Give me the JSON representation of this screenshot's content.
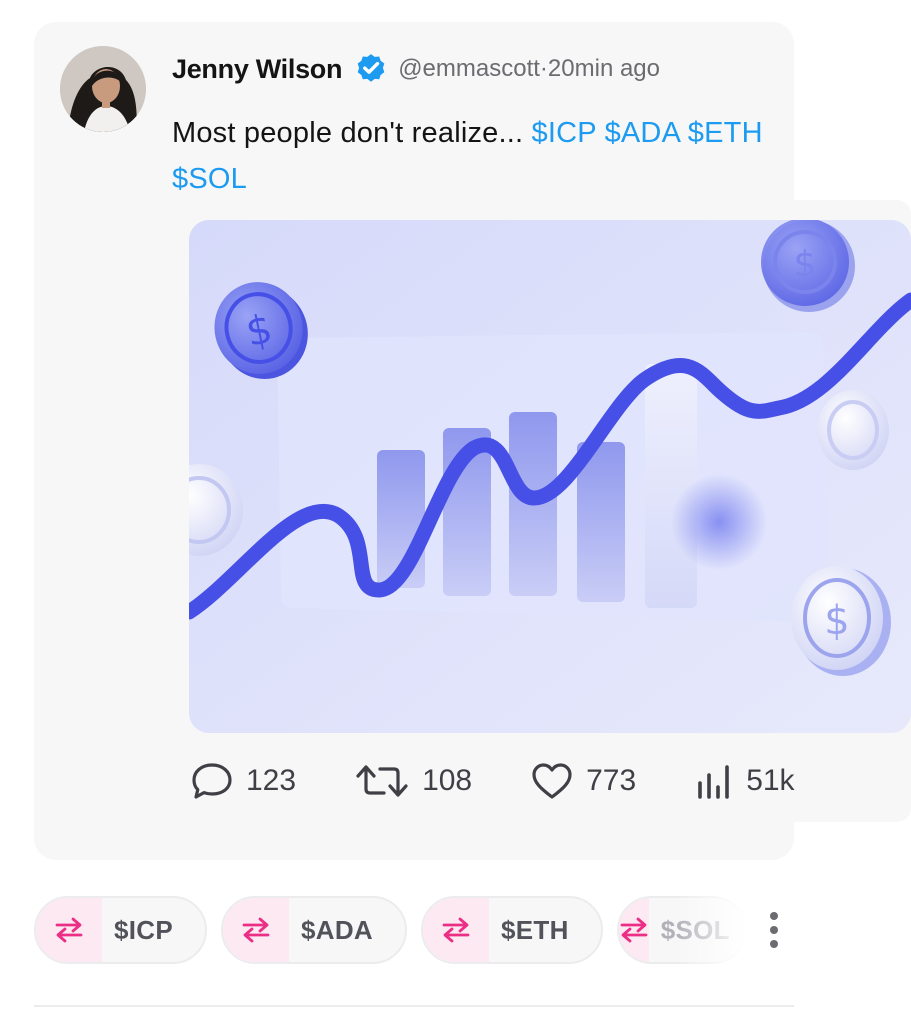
{
  "post": {
    "author_name": "Jenny Wilson",
    "verified": true,
    "handle": "@emmascott",
    "separator": "·",
    "time": "20min ago",
    "text_prefix": "Most people don't realize... ",
    "tags": [
      "$ICP",
      "$ADA",
      "$ETH",
      "$SOL"
    ],
    "media_icon": "growth-chart-coins-illustration"
  },
  "actions": [
    {
      "icon": "comment-icon",
      "count": "123"
    },
    {
      "icon": "repost-icon",
      "count": "108"
    },
    {
      "icon": "heart-icon",
      "count": "773"
    },
    {
      "icon": "views-icon",
      "count": "51k"
    }
  ],
  "chips": [
    {
      "icon": "swap-icon",
      "symbol": "$ICP"
    },
    {
      "icon": "swap-icon",
      "symbol": "$ADA"
    },
    {
      "icon": "swap-icon",
      "symbol": "$ETH"
    },
    {
      "icon": "swap-icon",
      "symbol": "$SOL"
    }
  ],
  "more_icon": "more-vertical-icon",
  "colors": {
    "tag": "#1d9bf0",
    "verified": "#1d9bf0",
    "swap": "#ec2f86",
    "card_bg": "#f7f7f8",
    "chart_line": "#4650e6"
  }
}
